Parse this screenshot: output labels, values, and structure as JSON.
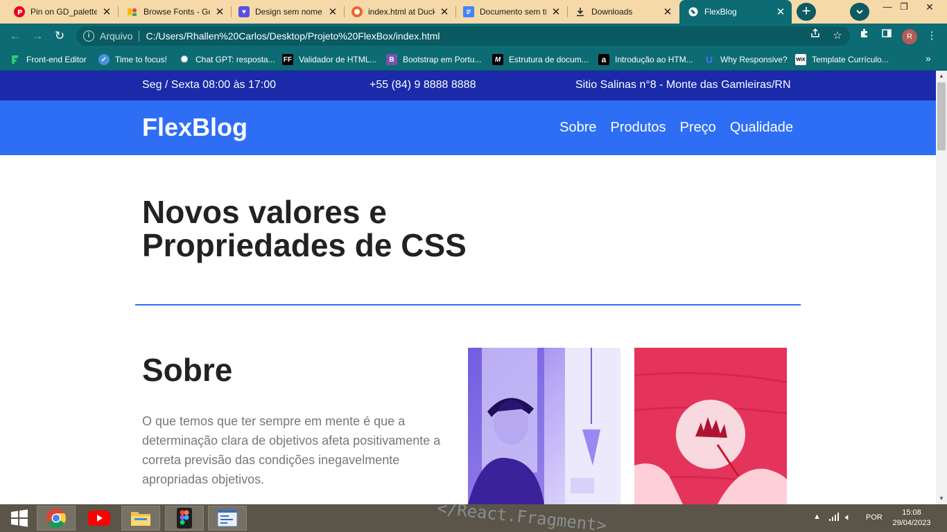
{
  "browser": {
    "tabs": [
      {
        "title": "Pin on GD_palette",
        "icon": "pinterest-icon",
        "color": "#e60023"
      },
      {
        "title": "Browse Fonts - Go",
        "icon": "google-fonts-icon",
        "color": "#4285f4"
      },
      {
        "title": "Design sem nome",
        "icon": "canva-heart-icon",
        "color": "#5b4fe0"
      },
      {
        "title": "index.html at Duck",
        "icon": "github-icon",
        "color": "#e9652b"
      },
      {
        "title": "Documento sem tí",
        "icon": "google-docs-icon",
        "color": "#4285f4"
      },
      {
        "title": "Downloads",
        "icon": "download-icon",
        "color": "#333333"
      },
      {
        "title": "FlexBlog",
        "icon": "globe-icon",
        "color": "#ffffff"
      }
    ],
    "new_tab": "+",
    "address": {
      "scheme": "Arquivo",
      "url": "C:/Users/Rhallen%20Carlos/Desktop/Projeto%20FlexBox/index.html"
    },
    "profile_initial": "R",
    "bookmarks": [
      {
        "label": "Front-end Editor",
        "icon": "frontend-editor-icon",
        "color": "#2ecc71"
      },
      {
        "label": "Time to focus!",
        "icon": "check-circle-icon",
        "color": "#4a90d9"
      },
      {
        "label": "Chat GPT: resposta...",
        "icon": "chatgpt-icon",
        "color": "#ffffff"
      },
      {
        "label": "Validador de HTML...",
        "icon": "ff-icon",
        "icon_text": "FF",
        "color": "#000000"
      },
      {
        "label": "Bootstrap em Portu...",
        "icon": "bootstrap-icon",
        "icon_text": "B",
        "color": "#7952b3"
      },
      {
        "label": "Estrutura de docum...",
        "icon": "mdn-icon",
        "icon_text": "M",
        "color": "#000000"
      },
      {
        "label": "Introdução ao HTM...",
        "icon": "alura-icon",
        "icon_text": "a",
        "color": "#000000"
      },
      {
        "label": "Why Responsive?",
        "icon": "u-icon",
        "icon_text": "U",
        "color": "#1a3bd6"
      },
      {
        "label": "Template Currículo...",
        "icon": "wix-icon",
        "icon_text": "WiX",
        "color": "#ffffff"
      }
    ],
    "bookmarks_more": "»"
  },
  "page": {
    "infobar": {
      "hours": "Seg / Sexta 08:00 às 17:00",
      "phone": "+55 (84) 9 8888 8888",
      "address": "Sitio Salinas n°8 - Monte das Gamleiras/RN"
    },
    "logo": "FlexBlog",
    "nav": [
      "Sobre",
      "Produtos",
      "Preço",
      "Qualidade"
    ],
    "hero_title": "Novos valores e Propriedades de CSS",
    "about": {
      "title": "Sobre",
      "text": "O que temos que ter sempre em mente é que a determinação clara de objetivos afeta positivamente a correta previsão das condições inegavelmente apropriadas objetivos."
    },
    "colors": {
      "topbar": "#1a2aa8",
      "header": "#2d6ef5",
      "accent": "#2d6ef5",
      "photo_red": "#e83d63",
      "photo_purple": "#8f7ae8"
    }
  },
  "taskbar": {
    "apps": [
      "chrome-icon",
      "youtube-icon",
      "file-explorer-icon",
      "figma-icon",
      "code-editor-icon"
    ],
    "wallpaper_text": "</React.Fragment>",
    "language": "POR",
    "time": "15:08",
    "date": "29/04/2023"
  }
}
